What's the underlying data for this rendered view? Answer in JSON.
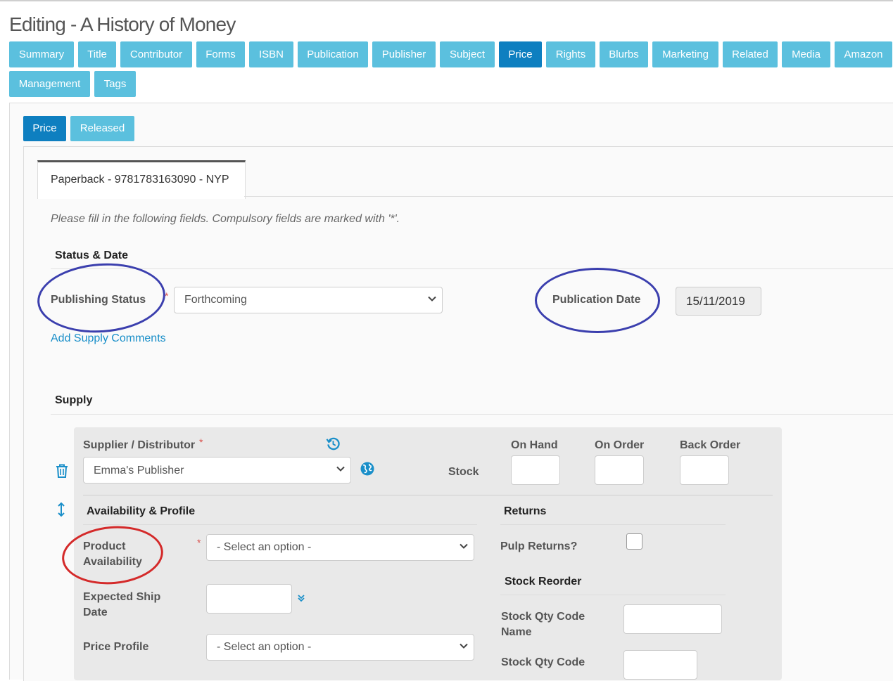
{
  "page": {
    "title": "Editing - A History of Money"
  },
  "tabs": [
    {
      "label": "Summary",
      "active": false
    },
    {
      "label": "Title",
      "active": false
    },
    {
      "label": "Contributor",
      "active": false
    },
    {
      "label": "Forms",
      "active": false
    },
    {
      "label": "ISBN",
      "active": false
    },
    {
      "label": "Publication",
      "active": false
    },
    {
      "label": "Publisher",
      "active": false
    },
    {
      "label": "Subject",
      "active": false
    },
    {
      "label": "Price",
      "active": true
    },
    {
      "label": "Rights",
      "active": false
    },
    {
      "label": "Blurbs",
      "active": false
    },
    {
      "label": "Marketing",
      "active": false
    },
    {
      "label": "Related",
      "active": false
    },
    {
      "label": "Media",
      "active": false
    },
    {
      "label": "Amazon",
      "active": false
    },
    {
      "label": "Management",
      "active": false
    },
    {
      "label": "Tags",
      "active": false
    }
  ],
  "subtabs": [
    {
      "label": "Price",
      "active": true
    },
    {
      "label": "Released",
      "active": false
    }
  ],
  "format_tab": {
    "label": "Paperback - 9781783163090 - NYP"
  },
  "instructions": "Please fill in the following fields. Compulsory fields are marked with '*'.",
  "status_date": {
    "heading": "Status & Date",
    "publishing_status_label": "Publishing Status",
    "publishing_status_value": "Forthcoming",
    "publication_date_label": "Publication Date",
    "publication_date_value": "15/11/2019",
    "add_supply_comments": "Add Supply Comments"
  },
  "supply": {
    "heading": "Supply",
    "supplier_label": "Supplier / Distributor",
    "supplier_value": "Emma's Publisher",
    "stock_label": "Stock",
    "on_hand_label": "On Hand",
    "on_order_label": "On Order",
    "back_order_label": "Back Order",
    "availability_heading": "Availability & Profile",
    "product_availability_label": "Product Availability",
    "product_availability_value": "- Select an option -",
    "expected_ship_date_label": "Expected Ship Date",
    "price_profile_label": "Price Profile",
    "price_profile_value": "- Select an option -",
    "returns_heading": "Returns",
    "pulp_returns_label": "Pulp Returns?",
    "stock_reorder_heading": "Stock Reorder",
    "stock_qty_code_name_label": "Stock Qty Code Name",
    "stock_qty_code_label": "Stock Qty Code"
  },
  "colors": {
    "tab": "#5bc0de",
    "tab_active": "#0e7fc0",
    "required": "#d9534f",
    "link": "#1a8fc9",
    "annotation_blue": "#3b3fae",
    "annotation_red": "#d42a2a"
  }
}
